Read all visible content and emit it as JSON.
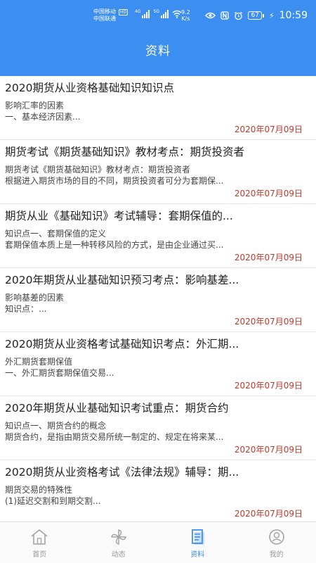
{
  "status_bar": {
    "carrier_1": "中国移动",
    "carrier_1_badge": "HD",
    "carrier_2": "中国联通",
    "signal_1_tag": "4G",
    "signal_2_tag": "5G",
    "net_speed_value": "9.2",
    "net_speed_unit": "K/s",
    "battery": "67",
    "time": "10:59"
  },
  "header": {
    "title": "资料"
  },
  "articles": [
    {
      "title": "2020期货从业资格基础知识知识点",
      "sub": "影响汇率的因素",
      "desc": "一、基本经济因素...",
      "date": "2020年07月09日"
    },
    {
      "title": "期货考试《期货基础知识》教材考点：期货投资者",
      "sub": "期货考试《期货基础知识》教材考点：期货投资者",
      "desc": "根据进入期货市场的目的不同，期货投资者可分为套期保...",
      "date": "2020年07月09日"
    },
    {
      "title": "期货从业《基础知识》考试辅导：套期保值的...",
      "sub": "知识点一、套期保值的定义",
      "desc": "套期保值本质上是一种转移风险的方式，是由企业通过买...",
      "date": "2020年07月09日"
    },
    {
      "title": "2020年期货从业基础知识预习考点：影响基差...",
      "sub": "影响基差的因素",
      "desc": "知识点：...",
      "date": "2020年07月09日"
    },
    {
      "title": "2020期货从业资格考试基础知识考点：外汇期...",
      "sub": "外汇期货套期保值",
      "desc": "一、外汇期货套期保值交易...",
      "date": "2020年07月09日"
    },
    {
      "title": "2020年期货从业基础知识考试重点：期货合约",
      "sub": "知识点一、期货合约的概念",
      "desc": "期货合约，是指由期货交易所统一制定的、规定在将来某...",
      "date": "2020年07月09日"
    },
    {
      "title": "2020期货从业资格考试《法律法规》辅导：期...",
      "sub": "期货交易的特殊性",
      "desc": "(1)延迟交割和到期交割...",
      "date": "2020年07月09日"
    }
  ],
  "tabbar": {
    "home": "首页",
    "dynamic": "动态",
    "materials": "资料",
    "mine": "我的"
  },
  "colors": {
    "primary": "#3d8ef1",
    "date": "#c0392b"
  }
}
